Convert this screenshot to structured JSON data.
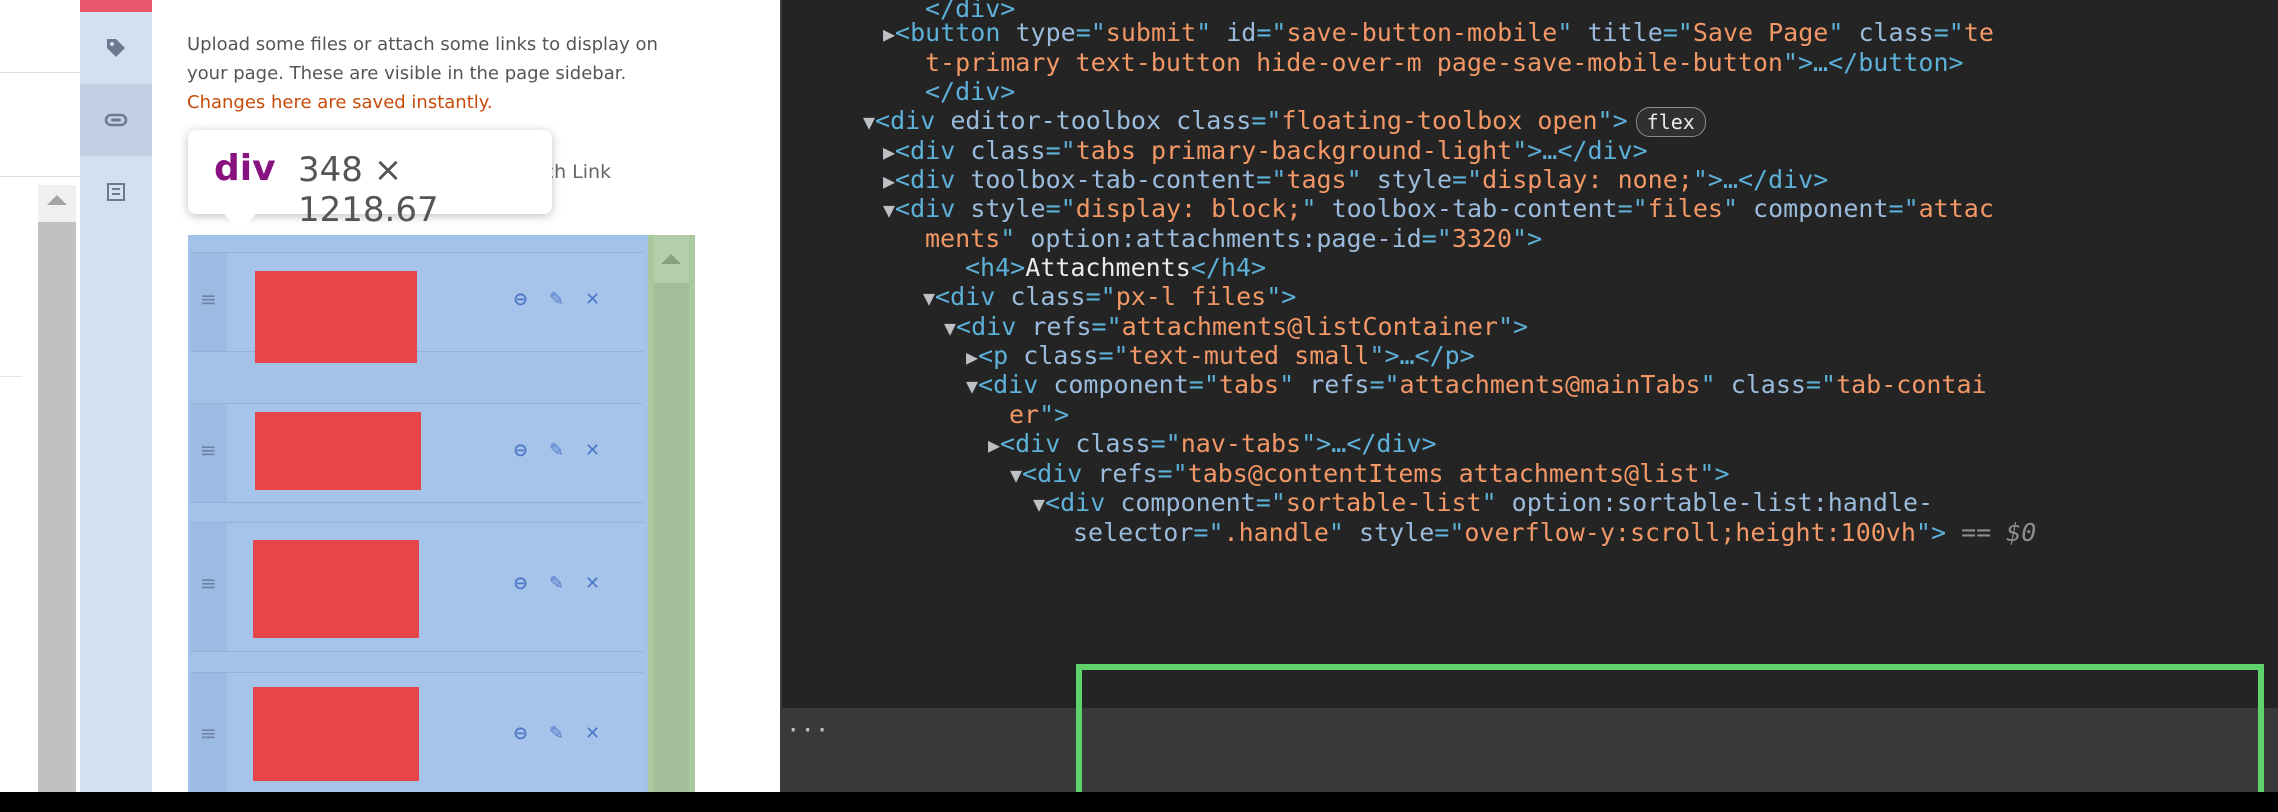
{
  "sidebar": {
    "intro_text": "Upload some files or attach some links to display on your page. These are visible in the page sidebar.",
    "intro_notice": "Changes here are saved instantly.",
    "attach_link_tab": "ach Link",
    "tab_icons": [
      "tag-icon",
      "paperclip-icon",
      "navigation-icon"
    ]
  },
  "tooltip": {
    "tag": "div",
    "size": "348 × 1218.67"
  },
  "attachments": [
    {
      "thumb_color": "#e8454b"
    },
    {
      "thumb_color": "#e8454b"
    },
    {
      "thumb_color": "#e8454b"
    },
    {
      "thumb_color": "#e8454b"
    }
  ],
  "colors": {
    "accent_orange": "#c94b0a",
    "highlight_blue": "#a3c2e8",
    "highlight_green": "#a9c89c",
    "selection_frame": "#5ed36b",
    "tag_purple": "#881280"
  },
  "devtools": {
    "lines": [
      {
        "seg": [
          [
            "tag",
            "</div>"
          ]
        ]
      },
      {
        "seg": [
          [
            "tag",
            "<button "
          ],
          [
            "attr",
            "type"
          ],
          [
            "tag",
            "=\""
          ],
          [
            "val",
            "submit"
          ],
          [
            "tag",
            "\" "
          ],
          [
            "attr",
            "id"
          ],
          [
            "tag",
            "=\""
          ],
          [
            "val",
            "save-button-mobile"
          ],
          [
            "tag",
            "\" "
          ],
          [
            "attr",
            "title"
          ],
          [
            "tag",
            "=\""
          ],
          [
            "val",
            "Save Page"
          ],
          [
            "tag",
            "\" "
          ],
          [
            "attr",
            "class"
          ],
          [
            "tag",
            "=\""
          ],
          [
            "val",
            "te"
          ]
        ]
      },
      {
        "seg": [
          [
            "val",
            "t-primary text-button hide-over-m page-save-mobile-button"
          ],
          [
            "tag",
            "\">…</button>"
          ]
        ]
      },
      {
        "seg": [
          [
            "tag",
            "</div>"
          ]
        ]
      },
      {
        "seg": [
          [
            "tag",
            "<div "
          ],
          [
            "attr",
            "editor-toolbox "
          ],
          [
            "attr",
            "class"
          ],
          [
            "tag",
            "=\""
          ],
          [
            "val",
            "floating-toolbox open"
          ],
          [
            "tag",
            "\">"
          ]
        ],
        "badge": "flex"
      },
      {
        "seg": [
          [
            "tag",
            "<div "
          ],
          [
            "attr",
            "class"
          ],
          [
            "tag",
            "=\""
          ],
          [
            "val",
            "tabs primary-background-light"
          ],
          [
            "tag",
            "\">…</div>"
          ]
        ]
      },
      {
        "seg": [
          [
            "tag",
            "<div "
          ],
          [
            "attr",
            "toolbox-tab-content"
          ],
          [
            "tag",
            "=\""
          ],
          [
            "val",
            "tags"
          ],
          [
            "tag",
            "\" "
          ],
          [
            "attr",
            "style"
          ],
          [
            "tag",
            "=\""
          ],
          [
            "val",
            "display: none;"
          ],
          [
            "tag",
            "\">…</div>"
          ]
        ]
      },
      {
        "seg": [
          [
            "tag",
            "<div "
          ],
          [
            "attr",
            "style"
          ],
          [
            "tag",
            "=\""
          ],
          [
            "val",
            "display: block;"
          ],
          [
            "tag",
            "\" "
          ],
          [
            "attr",
            "toolbox-tab-content"
          ],
          [
            "tag",
            "=\""
          ],
          [
            "val",
            "files"
          ],
          [
            "tag",
            "\" "
          ],
          [
            "attr",
            "component"
          ],
          [
            "tag",
            "=\""
          ],
          [
            "val",
            "attac"
          ]
        ]
      },
      {
        "seg": [
          [
            "val",
            "ments"
          ],
          [
            "tag",
            "\" "
          ],
          [
            "attr",
            "option:attachments:page-id"
          ],
          [
            "tag",
            "=\""
          ],
          [
            "val",
            "3320"
          ],
          [
            "tag",
            "\">"
          ]
        ]
      },
      {
        "seg": [
          [
            "tag",
            "<h4>"
          ],
          [
            "txt",
            "Attachments"
          ],
          [
            "tag",
            "</h4>"
          ]
        ]
      },
      {
        "seg": [
          [
            "tag",
            "<div "
          ],
          [
            "attr",
            "class"
          ],
          [
            "tag",
            "=\""
          ],
          [
            "val",
            "px-l files"
          ],
          [
            "tag",
            "\">"
          ]
        ]
      },
      {
        "seg": [
          [
            "tag",
            "<div "
          ],
          [
            "attr",
            "refs"
          ],
          [
            "tag",
            "=\""
          ],
          [
            "val",
            "attachments@listContainer"
          ],
          [
            "tag",
            "\">"
          ]
        ]
      },
      {
        "seg": [
          [
            "tag",
            "<p "
          ],
          [
            "attr",
            "class"
          ],
          [
            "tag",
            "=\""
          ],
          [
            "val",
            "text-muted small"
          ],
          [
            "tag",
            "\">…</p>"
          ]
        ]
      },
      {
        "seg": [
          [
            "tag",
            "<div "
          ],
          [
            "attr",
            "component"
          ],
          [
            "tag",
            "=\""
          ],
          [
            "val",
            "tabs"
          ],
          [
            "tag",
            "\" "
          ],
          [
            "attr",
            "refs"
          ],
          [
            "tag",
            "=\""
          ],
          [
            "val",
            "attachments@mainTabs"
          ],
          [
            "tag",
            "\" "
          ],
          [
            "attr",
            "class"
          ],
          [
            "tag",
            "=\""
          ],
          [
            "val",
            "tab-contai"
          ]
        ]
      },
      {
        "seg": [
          [
            "val",
            "er"
          ],
          [
            "tag",
            "\">"
          ]
        ]
      },
      {
        "seg": [
          [
            "tag",
            "<div "
          ],
          [
            "attr",
            "class"
          ],
          [
            "tag",
            "=\""
          ],
          [
            "val",
            "nav-tabs"
          ],
          [
            "tag",
            "\">…</div>"
          ]
        ]
      },
      {
        "seg": [
          [
            "tag",
            "<div "
          ],
          [
            "attr",
            "refs"
          ],
          [
            "tag",
            "=\""
          ],
          [
            "val",
            "tabs@contentItems attachments@list"
          ],
          [
            "tag",
            "\">"
          ]
        ]
      },
      {
        "seg": [
          [
            "tag",
            "<div "
          ],
          [
            "attr",
            "component"
          ],
          [
            "tag",
            "=\""
          ],
          [
            "val",
            "sortable-list"
          ],
          [
            "tag",
            "\" "
          ],
          [
            "attr",
            "option:sortable-list:handle-"
          ]
        ]
      },
      {
        "seg": [
          [
            "attr",
            "selector"
          ],
          [
            "tag",
            "=\""
          ],
          [
            "val",
            ".handle"
          ],
          [
            "tag",
            "\" "
          ],
          [
            "attr",
            "style"
          ],
          [
            "tag",
            "=\""
          ],
          [
            "val",
            "overflow-y:scroll;height:100vh"
          ],
          [
            "tag",
            "\">"
          ]
        ],
        "suffix": " == $0"
      }
    ],
    "ellipsis": "···"
  }
}
